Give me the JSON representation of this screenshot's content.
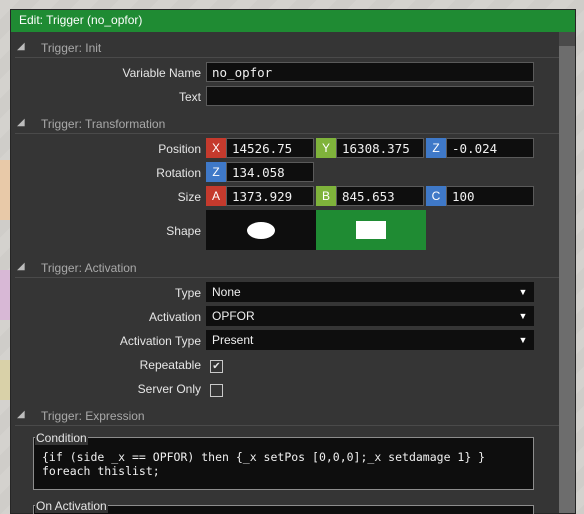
{
  "window": {
    "title": "Edit: Trigger (no_opfor)"
  },
  "sections": {
    "init": "Trigger: Init",
    "transformation": "Trigger: Transformation",
    "activation": "Trigger: Activation",
    "expression": "Trigger: Expression"
  },
  "init": {
    "variable_name_label": "Variable Name",
    "variable_name_value": "no_opfor",
    "text_label": "Text",
    "text_value": ""
  },
  "transformation": {
    "position_label": "Position",
    "position": {
      "x_axis": "X",
      "x": "14526.75",
      "y_axis": "Y",
      "y": "16308.375",
      "z_axis": "Z",
      "z": "-0.024"
    },
    "rotation_label": "Rotation",
    "rotation": {
      "z_axis": "Z",
      "z": "134.058"
    },
    "size_label": "Size",
    "size": {
      "a_axis": "A",
      "a": "1373.929",
      "b_axis": "B",
      "b": "845.653",
      "c_axis": "C",
      "c": "100"
    },
    "shape_label": "Shape",
    "shape_options": [
      "ellipse",
      "rectangle"
    ],
    "shape_selected": "rectangle"
  },
  "activation": {
    "type_label": "Type",
    "type_value": "None",
    "activation_label": "Activation",
    "activation_value": "OPFOR",
    "activation_type_label": "Activation Type",
    "activation_type_value": "Present",
    "repeatable_label": "Repeatable",
    "repeatable_checked": true,
    "server_only_label": "Server Only",
    "server_only_checked": false
  },
  "expression": {
    "condition_label": "Condition",
    "condition_line1": "{if (side _x == OPFOR) then {_x setPos [0,0,0];_x setdamage 1} }",
    "condition_line2": "foreach thislist;",
    "on_activation_label": "On Activation"
  },
  "colors": {
    "titlebar": "#1f8b33",
    "panel": "#353535",
    "field": "#0e0e0e",
    "axis_red": "#c53a2d",
    "axis_green": "#7fb33b",
    "axis_blue": "#3f79c8",
    "shape_selected": "#1f8b33"
  },
  "icons": {
    "collapse": "triangle-collapse-icon",
    "dropdown": "chevron-down-icon",
    "check": "checkmark-icon"
  }
}
